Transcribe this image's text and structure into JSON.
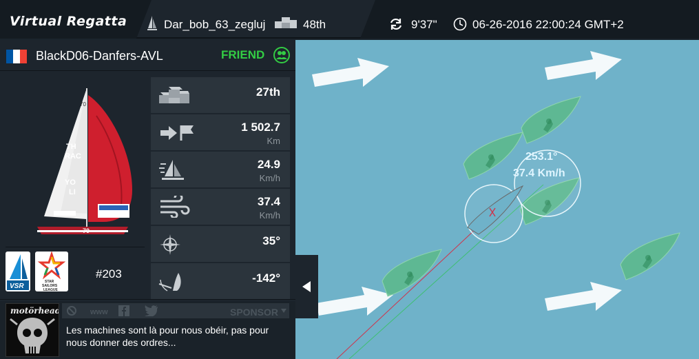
{
  "header": {
    "logo": "Virtual Regatta",
    "player_name": "Dar_bob_63_zegluj",
    "player_rank": "48th",
    "refresh_time": "9'37\"",
    "datetime": "06-26-2016 22:00:24 GMT+2"
  },
  "skipper": {
    "name": "BlackD06-Danfers-AVL",
    "flag_colors": [
      "#0055a4",
      "#ffffff",
      "#ef4135"
    ],
    "status": "FRIEND",
    "status_color": "#33cc44",
    "number": "#203",
    "logos": [
      "VSR",
      "STAR SAILORS LEAGUE"
    ]
  },
  "stats": [
    {
      "icon": "podium-icon",
      "value": "27th",
      "unit": ""
    },
    {
      "icon": "distance-to-finish-icon",
      "value": "1 502.7",
      "unit": "Km"
    },
    {
      "icon": "boat-speed-icon",
      "value": "24.9",
      "unit": "Km/h"
    },
    {
      "icon": "wind-speed-icon",
      "value": "37.4",
      "unit": "Km/h"
    },
    {
      "icon": "compass-icon",
      "value": "35°",
      "unit": ""
    },
    {
      "icon": "wind-angle-icon",
      "value": "-142°",
      "unit": ""
    }
  ],
  "sponsor": {
    "www_label": "www",
    "label": "SPONSOR",
    "image_text": "motörhead",
    "quote": "Les machines sont là pour nous obéir, pas pour nous donner des ordres..."
  },
  "map": {
    "heading": "253.1°",
    "wind_speed": "37.4 Km/h",
    "sea_color": "#6fb2c9",
    "boat_color": "#5cb88a"
  },
  "panel_toggle": "◀"
}
